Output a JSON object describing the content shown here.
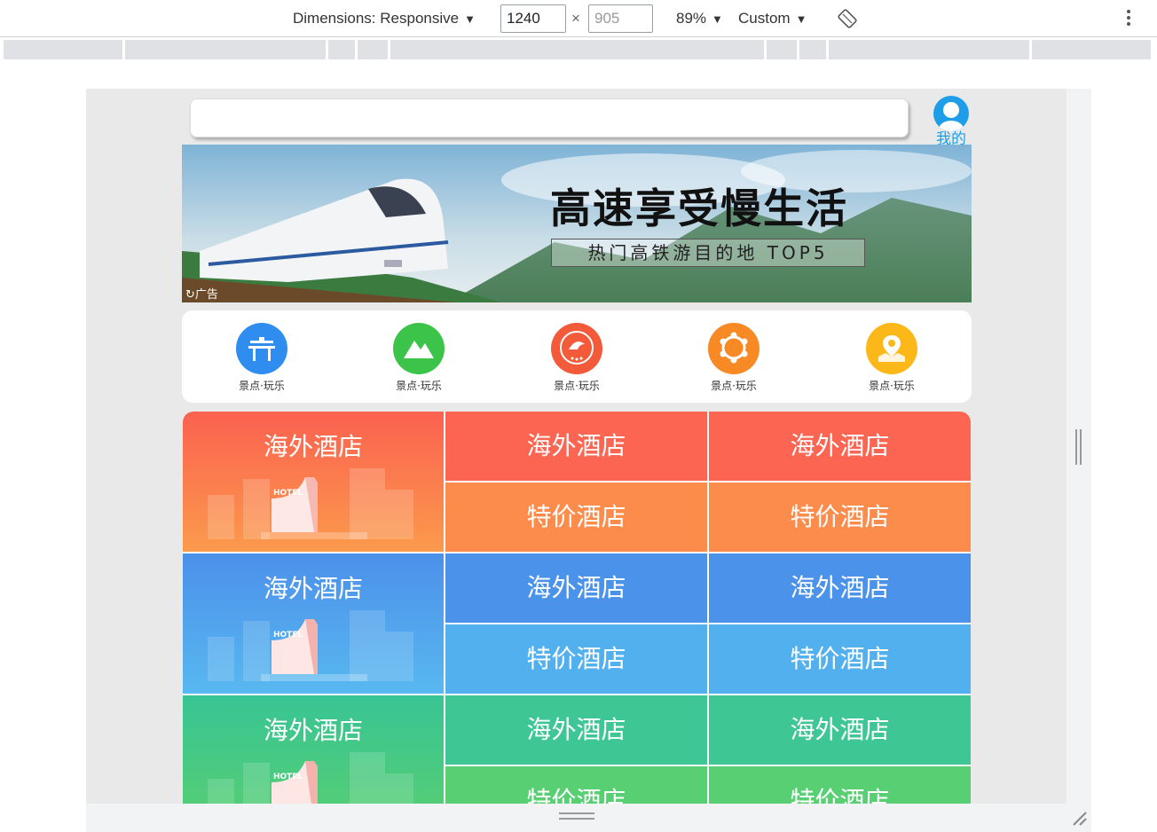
{
  "devtools": {
    "dimensions_label": "Dimensions: Responsive",
    "width": "1240",
    "height_placeholder": "905",
    "times": "×",
    "zoom": "89%",
    "throttle": "Custom"
  },
  "page": {
    "mine_label": "我的",
    "banner": {
      "title": "高速享受慢生活",
      "subtitle": "热门高铁游目的地 TOP5",
      "ad_label": "广告"
    },
    "categories": [
      {
        "label": "景点·玩乐",
        "color": "#2f8df0"
      },
      {
        "label": "景点·玩乐",
        "color": "#3cc44a"
      },
      {
        "label": "景点·玩乐",
        "color": "#f25a3a"
      },
      {
        "label": "景点·玩乐",
        "color": "#f88a26"
      },
      {
        "label": "景点·玩乐",
        "color": "#fbb818"
      }
    ],
    "hotel_rows": [
      {
        "theme": "orange",
        "big": "海外酒店",
        "top": [
          "海外酒店",
          "海外酒店"
        ],
        "bottom": [
          "特价酒店",
          "特价酒店"
        ],
        "big_sign": "HOTEL"
      },
      {
        "theme": "blue",
        "big": "海外酒店",
        "top": [
          "海外酒店",
          "海外酒店"
        ],
        "bottom": [
          "特价酒店",
          "特价酒店"
        ],
        "big_sign": "HOTEL"
      },
      {
        "theme": "green",
        "big": "海外酒店",
        "top": [
          "海外酒店",
          "海外酒店"
        ],
        "bottom": [
          "特价酒店",
          "特价酒店"
        ],
        "big_sign": "HOTEL"
      }
    ]
  }
}
